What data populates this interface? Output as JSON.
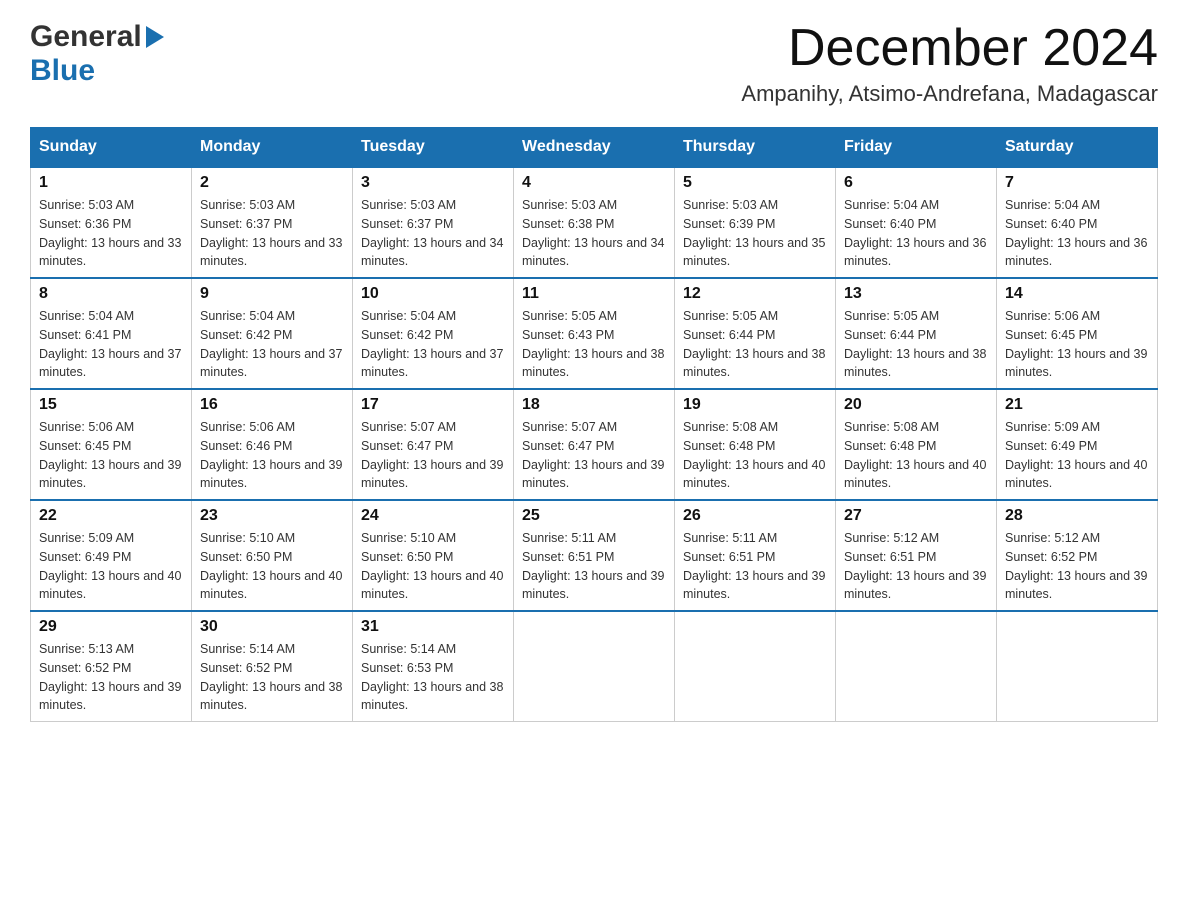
{
  "logo": {
    "general": "General",
    "blue": "Blue",
    "triangle": "▶"
  },
  "title": "December 2024",
  "location": "Ampanihy, Atsimo-Andrefana, Madagascar",
  "days_of_week": [
    "Sunday",
    "Monday",
    "Tuesday",
    "Wednesday",
    "Thursday",
    "Friday",
    "Saturday"
  ],
  "weeks": [
    [
      {
        "day": "1",
        "sunrise": "5:03 AM",
        "sunset": "6:36 PM",
        "daylight": "13 hours and 33 minutes."
      },
      {
        "day": "2",
        "sunrise": "5:03 AM",
        "sunset": "6:37 PM",
        "daylight": "13 hours and 33 minutes."
      },
      {
        "day": "3",
        "sunrise": "5:03 AM",
        "sunset": "6:37 PM",
        "daylight": "13 hours and 34 minutes."
      },
      {
        "day": "4",
        "sunrise": "5:03 AM",
        "sunset": "6:38 PM",
        "daylight": "13 hours and 34 minutes."
      },
      {
        "day": "5",
        "sunrise": "5:03 AM",
        "sunset": "6:39 PM",
        "daylight": "13 hours and 35 minutes."
      },
      {
        "day": "6",
        "sunrise": "5:04 AM",
        "sunset": "6:40 PM",
        "daylight": "13 hours and 36 minutes."
      },
      {
        "day": "7",
        "sunrise": "5:04 AM",
        "sunset": "6:40 PM",
        "daylight": "13 hours and 36 minutes."
      }
    ],
    [
      {
        "day": "8",
        "sunrise": "5:04 AM",
        "sunset": "6:41 PM",
        "daylight": "13 hours and 37 minutes."
      },
      {
        "day": "9",
        "sunrise": "5:04 AM",
        "sunset": "6:42 PM",
        "daylight": "13 hours and 37 minutes."
      },
      {
        "day": "10",
        "sunrise": "5:04 AM",
        "sunset": "6:42 PM",
        "daylight": "13 hours and 37 minutes."
      },
      {
        "day": "11",
        "sunrise": "5:05 AM",
        "sunset": "6:43 PM",
        "daylight": "13 hours and 38 minutes."
      },
      {
        "day": "12",
        "sunrise": "5:05 AM",
        "sunset": "6:44 PM",
        "daylight": "13 hours and 38 minutes."
      },
      {
        "day": "13",
        "sunrise": "5:05 AM",
        "sunset": "6:44 PM",
        "daylight": "13 hours and 38 minutes."
      },
      {
        "day": "14",
        "sunrise": "5:06 AM",
        "sunset": "6:45 PM",
        "daylight": "13 hours and 39 minutes."
      }
    ],
    [
      {
        "day": "15",
        "sunrise": "5:06 AM",
        "sunset": "6:45 PM",
        "daylight": "13 hours and 39 minutes."
      },
      {
        "day": "16",
        "sunrise": "5:06 AM",
        "sunset": "6:46 PM",
        "daylight": "13 hours and 39 minutes."
      },
      {
        "day": "17",
        "sunrise": "5:07 AM",
        "sunset": "6:47 PM",
        "daylight": "13 hours and 39 minutes."
      },
      {
        "day": "18",
        "sunrise": "5:07 AM",
        "sunset": "6:47 PM",
        "daylight": "13 hours and 39 minutes."
      },
      {
        "day": "19",
        "sunrise": "5:08 AM",
        "sunset": "6:48 PM",
        "daylight": "13 hours and 40 minutes."
      },
      {
        "day": "20",
        "sunrise": "5:08 AM",
        "sunset": "6:48 PM",
        "daylight": "13 hours and 40 minutes."
      },
      {
        "day": "21",
        "sunrise": "5:09 AM",
        "sunset": "6:49 PM",
        "daylight": "13 hours and 40 minutes."
      }
    ],
    [
      {
        "day": "22",
        "sunrise": "5:09 AM",
        "sunset": "6:49 PM",
        "daylight": "13 hours and 40 minutes."
      },
      {
        "day": "23",
        "sunrise": "5:10 AM",
        "sunset": "6:50 PM",
        "daylight": "13 hours and 40 minutes."
      },
      {
        "day": "24",
        "sunrise": "5:10 AM",
        "sunset": "6:50 PM",
        "daylight": "13 hours and 40 minutes."
      },
      {
        "day": "25",
        "sunrise": "5:11 AM",
        "sunset": "6:51 PM",
        "daylight": "13 hours and 39 minutes."
      },
      {
        "day": "26",
        "sunrise": "5:11 AM",
        "sunset": "6:51 PM",
        "daylight": "13 hours and 39 minutes."
      },
      {
        "day": "27",
        "sunrise": "5:12 AM",
        "sunset": "6:51 PM",
        "daylight": "13 hours and 39 minutes."
      },
      {
        "day": "28",
        "sunrise": "5:12 AM",
        "sunset": "6:52 PM",
        "daylight": "13 hours and 39 minutes."
      }
    ],
    [
      {
        "day": "29",
        "sunrise": "5:13 AM",
        "sunset": "6:52 PM",
        "daylight": "13 hours and 39 minutes."
      },
      {
        "day": "30",
        "sunrise": "5:14 AM",
        "sunset": "6:52 PM",
        "daylight": "13 hours and 38 minutes."
      },
      {
        "day": "31",
        "sunrise": "5:14 AM",
        "sunset": "6:53 PM",
        "daylight": "13 hours and 38 minutes."
      },
      null,
      null,
      null,
      null
    ]
  ]
}
